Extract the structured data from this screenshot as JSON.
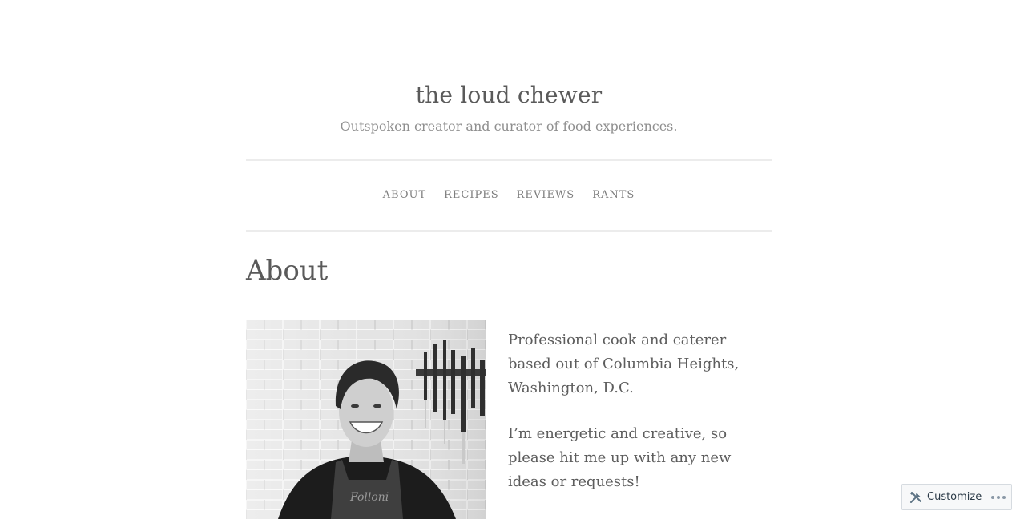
{
  "site": {
    "title": "the loud chewer",
    "description": "Outspoken creator and curator of food experiences."
  },
  "nav": {
    "items": [
      {
        "label": "ABOUT"
      },
      {
        "label": "RECIPES"
      },
      {
        "label": "REVIEWS"
      },
      {
        "label": "RANTS"
      }
    ]
  },
  "page": {
    "title": "About",
    "paragraphs": [
      "Professional cook and caterer based out of Columbia Heights, Washington, D.C.",
      "I’m energetic and creative, so please hit me up with any new ideas or requests!"
    ]
  },
  "customize": {
    "label": "Customize",
    "icon": "tools-icon",
    "more_icon": "ellipsis-icon"
  }
}
